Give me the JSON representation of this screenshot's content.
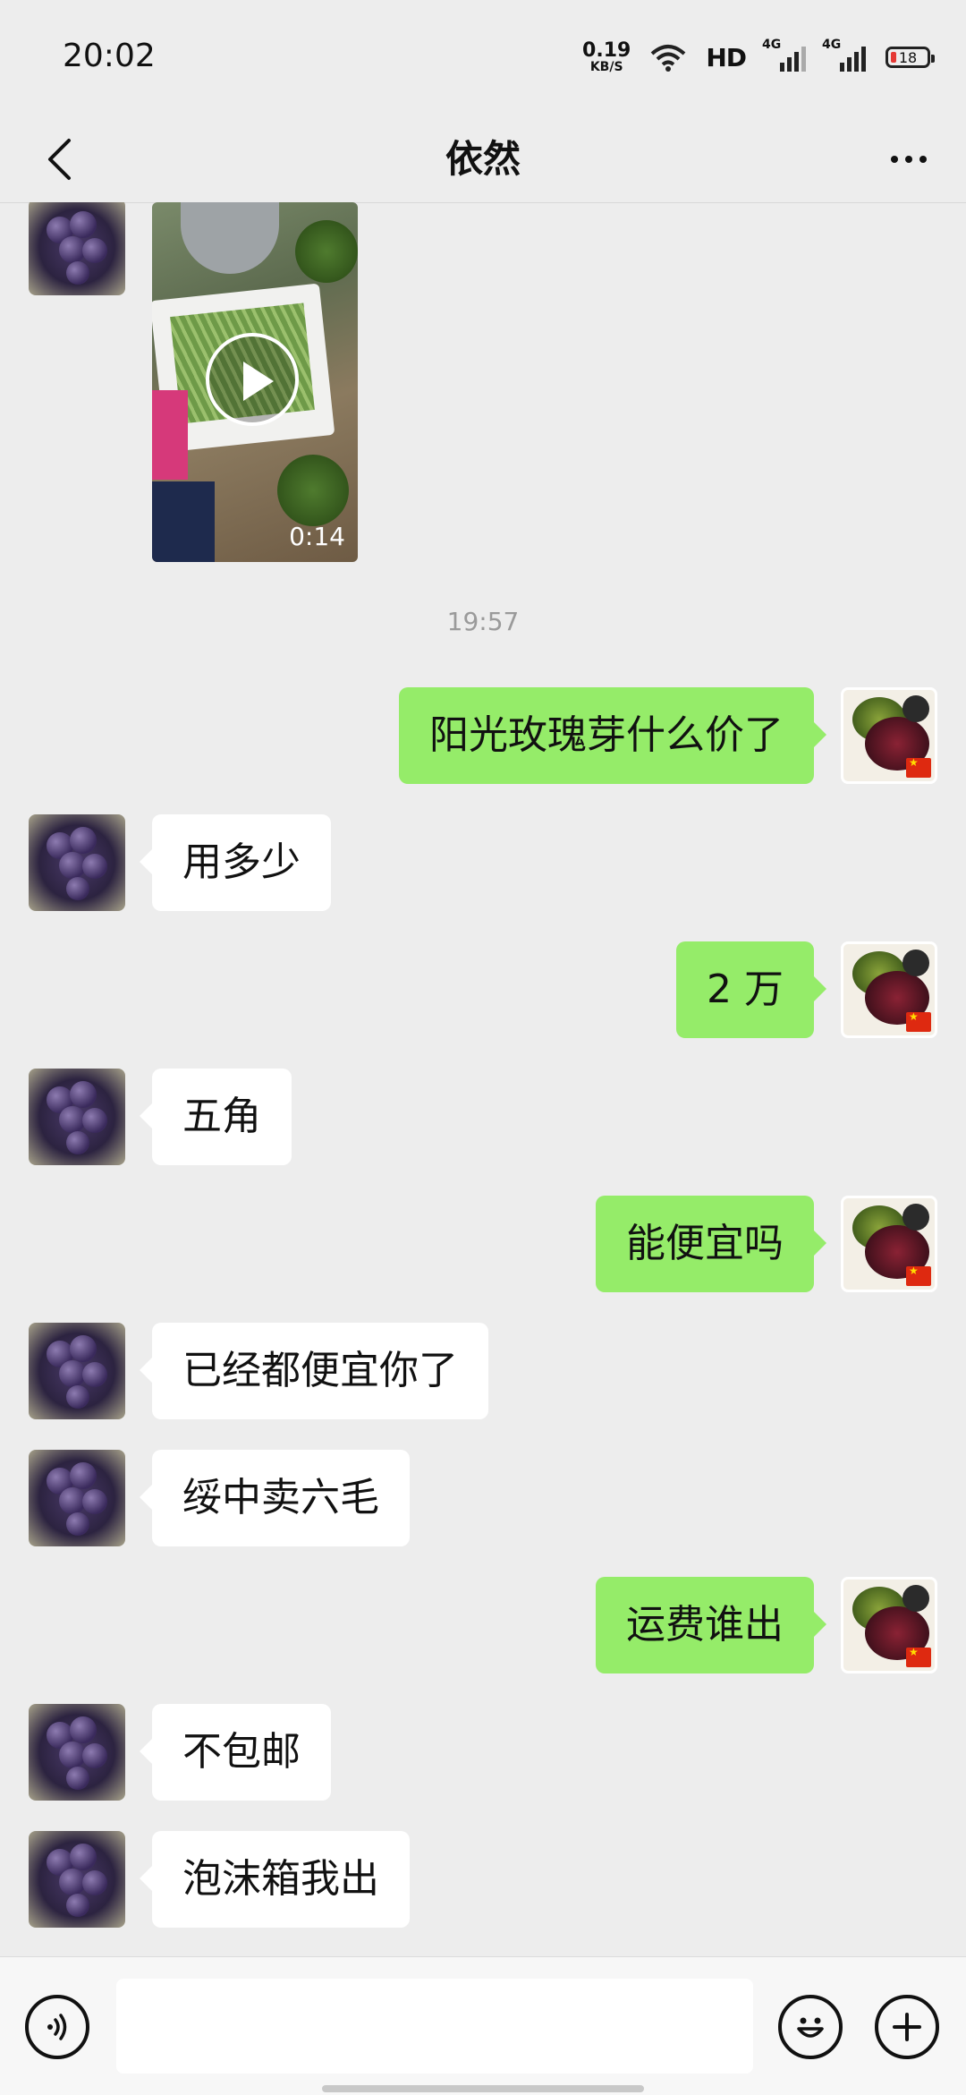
{
  "status_bar": {
    "time": "20:02",
    "net_speed_value": "0.19",
    "net_speed_unit": "KB/S",
    "hd_label": "HD",
    "sim1_label": "4G",
    "sim2_label": "4G",
    "battery_level": "18"
  },
  "header": {
    "title": "依然"
  },
  "video_message": {
    "duration": "0:14"
  },
  "timestamp": "19:57",
  "messages": [
    {
      "from": "self",
      "text": "阳光玫瑰芽什么价了"
    },
    {
      "from": "peer",
      "text": "用多少"
    },
    {
      "from": "self",
      "text": "2 万"
    },
    {
      "from": "peer",
      "text": "五角"
    },
    {
      "from": "self",
      "text": "能便宜吗"
    },
    {
      "from": "peer",
      "text": "已经都便宜你了"
    },
    {
      "from": "peer",
      "text": "绥中卖六毛"
    },
    {
      "from": "self",
      "text": "运费谁出"
    },
    {
      "from": "peer",
      "text": "不包邮"
    },
    {
      "from": "peer",
      "text": "泡沫箱我出"
    }
  ],
  "input": {
    "value": ""
  },
  "colors": {
    "background": "#ededed",
    "self_bubble": "#95ec69",
    "peer_bubble": "#ffffff"
  }
}
